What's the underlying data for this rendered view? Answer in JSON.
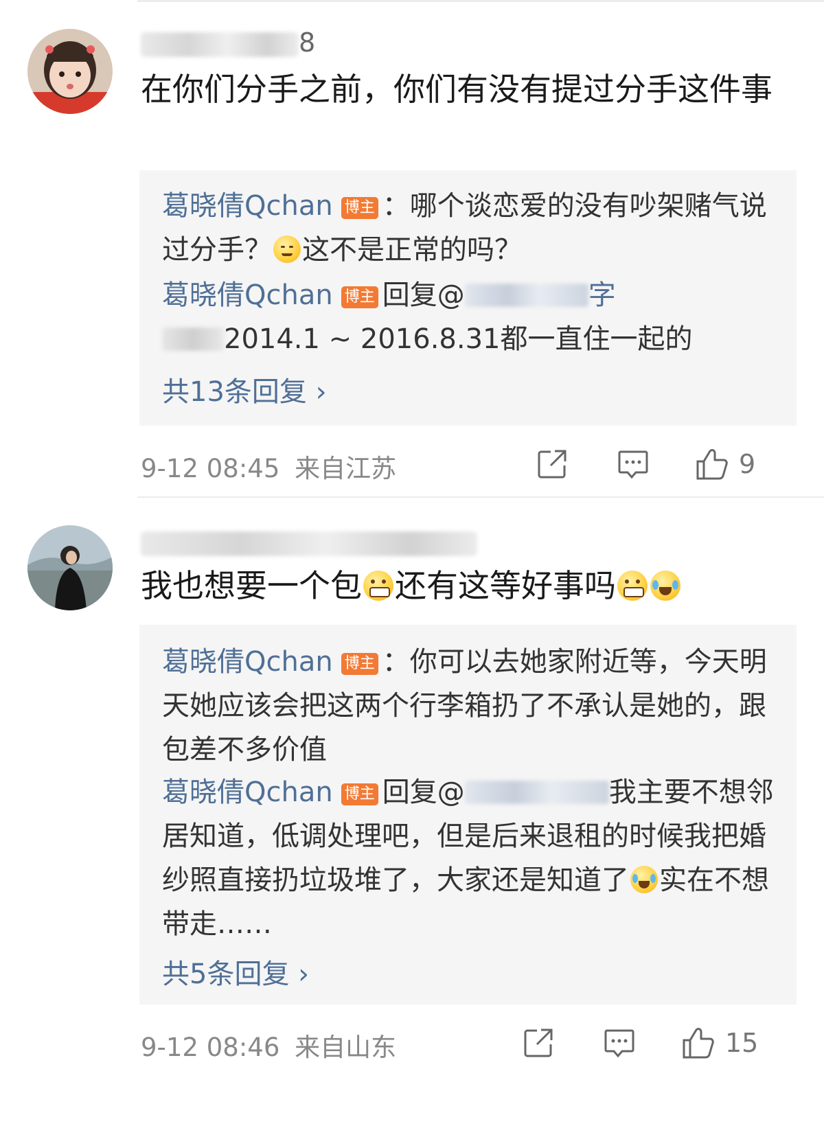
{
  "comments": [
    {
      "username_tail": "8",
      "text": "在你们分手之前，你们有没有提过分手这件事",
      "replies": [
        {
          "author": "葛晓倩Qchan",
          "badge": "博主",
          "text_a": "：哪个谈恋爱的没有吵架赌气说过分手？",
          "emoji": "sweat-smile-emoji",
          "text_b": "这不是正常的吗？"
        },
        {
          "author": "葛晓倩Qchan",
          "badge": "博主",
          "text_a": "回复@",
          "mention_tail": "字",
          "text_b": "2014.1 ~ 2016.8.31都一直住一起的"
        }
      ],
      "more_replies": "共13条回复 ›",
      "time": "9-12 08:45",
      "location": "来自江苏",
      "like_count": "9"
    },
    {
      "text_a": "我也想要一个包",
      "text_b": "还有这等好事吗",
      "replies": [
        {
          "author": "葛晓倩Qchan",
          "badge": "博主",
          "text": "：你可以去她家附近等，今天明天她应该会把这两个行李箱扔了不承认是她的，跟包差不多价值"
        },
        {
          "author": "葛晓倩Qchan",
          "badge": "博主",
          "text_a": "回复@",
          "text_b": "我主要不想邻居知道，低调处理吧，但是后来退租的时候我把婚纱照直接扔垃圾堆了，大家还是知道了",
          "emoji": "laugh-cry-emoji",
          "text_c": "实在不想带走……"
        }
      ],
      "more_replies": "共5条回复 ›",
      "time": "9-12 08:46",
      "location": "来自山东",
      "like_count": "15"
    }
  ],
  "colors": {
    "username_link": "#4f6f96",
    "badge": "#f27a34",
    "reply_bg": "#f5f5f5"
  },
  "icons": [
    "share-icon",
    "comment-icon",
    "like-icon"
  ]
}
